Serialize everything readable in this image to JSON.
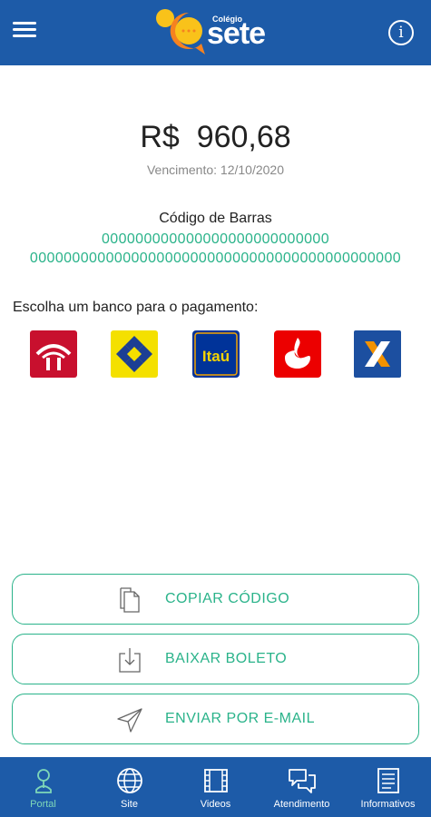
{
  "header": {
    "logo_small": "Colégio",
    "logo_word": "sete",
    "info_glyph": "i",
    "icons": {
      "menu": "hamburger-menu-icon",
      "info": "info-icon"
    }
  },
  "payment": {
    "currency": "R$",
    "amount": "960,68",
    "due_label": "Vencimento: 12/10/2020"
  },
  "barcode": {
    "title": "Código de Barras",
    "line1": "000000000000000000000000000",
    "line2": "00000000000000000000000000000000000000000000"
  },
  "banks": {
    "title": "Escolha um banco para o pagamento:",
    "items": [
      {
        "name": "bradesco",
        "color": "#c8102e"
      },
      {
        "name": "banco-do-brasil",
        "color": "#f4e000"
      },
      {
        "name": "itau",
        "label": "Itaú",
        "color": "#003399"
      },
      {
        "name": "santander",
        "color": "#ec0000"
      },
      {
        "name": "caixa",
        "color": "#1c4fa0"
      }
    ]
  },
  "actions": {
    "copy_label": "COPIAR CÓDIGO",
    "download_label": "BAIXAR BOLETO",
    "email_label": "ENVIAR POR E-MAIL",
    "accent": "#2ab38a"
  },
  "nav": {
    "items": [
      {
        "label": "Portal",
        "icon": "person-icon",
        "active": true
      },
      {
        "label": "Site",
        "icon": "globe-icon"
      },
      {
        "label": "Videos",
        "icon": "film-icon"
      },
      {
        "label": "Atendimento",
        "icon": "chat-bubbles-icon"
      },
      {
        "label": "Informativos",
        "icon": "newspaper-icon"
      }
    ],
    "background": "#1d5ba8",
    "active_color": "#7ed7b8"
  }
}
